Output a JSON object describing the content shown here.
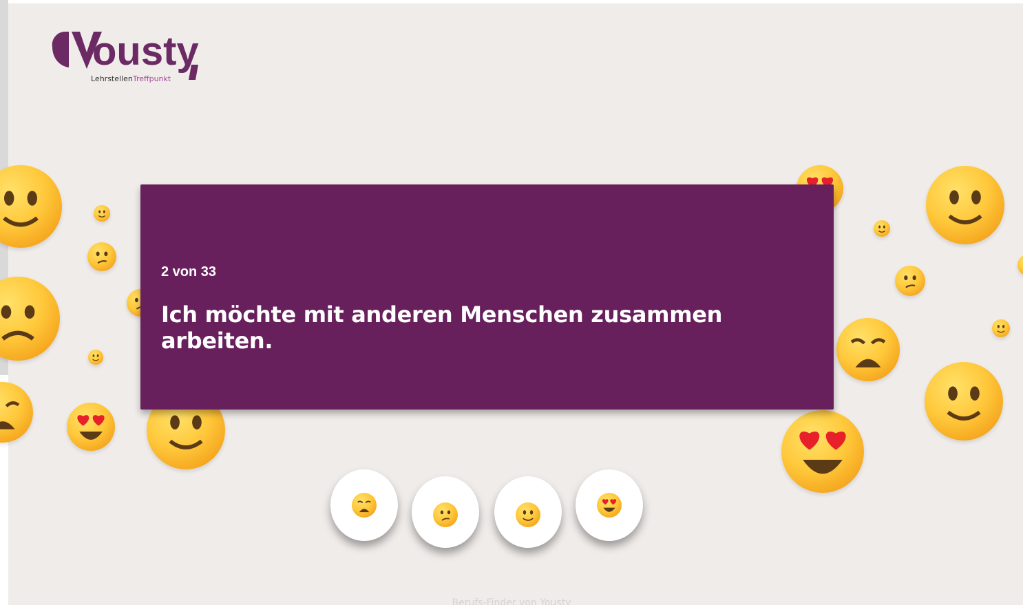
{
  "logo": {
    "wordmark": "Yousty",
    "tagline_part1": "Lehrstellen",
    "tagline_part2": "Treffpunkt",
    "tagline_part3": "punkt"
  },
  "question": {
    "progress": "2 von 33",
    "text": "Ich möchte mit anderen Menschen zusammen arbeiten."
  },
  "answers": [
    {
      "name": "answer-weary",
      "icon": "weary-face-icon"
    },
    {
      "name": "answer-confused",
      "icon": "confused-face-icon"
    },
    {
      "name": "answer-smile",
      "icon": "slightly-smiling-face-icon"
    },
    {
      "name": "answer-heart-eyes",
      "icon": "heart-eyes-face-icon"
    }
  ],
  "footer": {
    "text": "Berufs-Finder von Yousty"
  },
  "colors": {
    "brand_purple": "#68205d",
    "background": "#f0ecea",
    "emoji_yellow": "#ffc83b"
  }
}
